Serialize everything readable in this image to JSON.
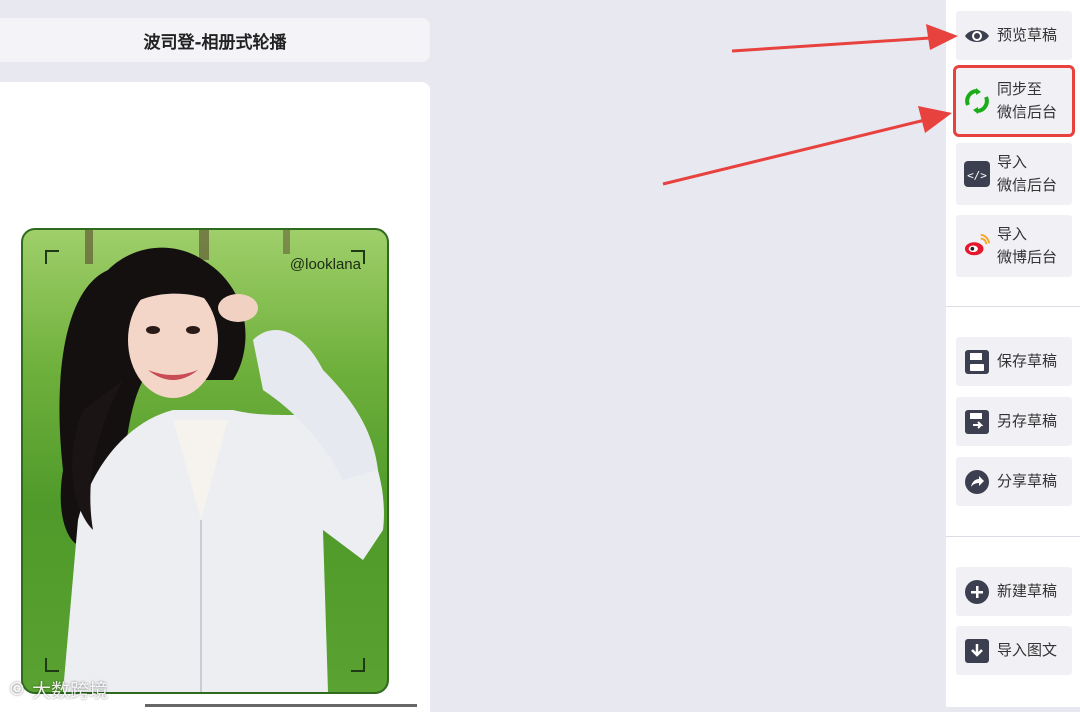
{
  "editor": {
    "title": "波司登-相册式轮播",
    "photo_handle": "@looklana"
  },
  "watermark": {
    "logo": "©",
    "text": "大数跨境"
  },
  "toolbar": {
    "preview": "预览草稿",
    "sync_wechat": "同步至\n微信后台",
    "import_wechat": "导入\n微信后台",
    "import_weibo": "导入\n微博后台",
    "save": "保存草稿",
    "save_as": "另存草稿",
    "share": "分享草稿",
    "new": "新建草稿",
    "import_article": "导入图文"
  },
  "colors": {
    "highlight": "#e8423f",
    "arrow": "#e8423f",
    "icon_dark": "#3c3f4f",
    "wechat_green": "#1aad19"
  }
}
